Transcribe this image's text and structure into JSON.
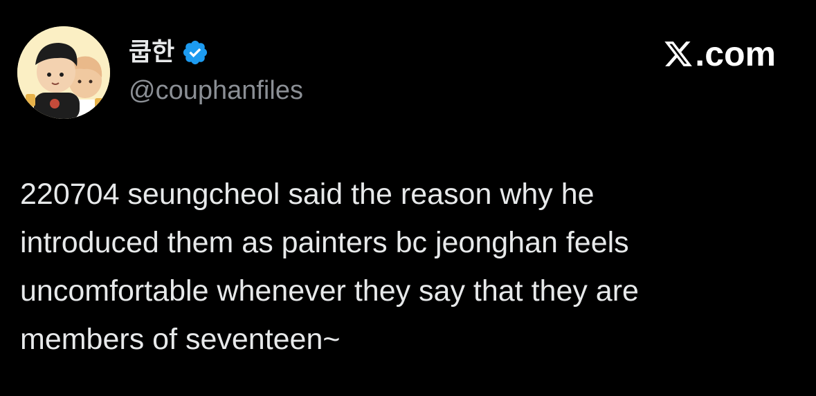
{
  "author": {
    "display_name": "쿱한",
    "handle": "@couphanfiles",
    "verified": true,
    "avatar": "couple-cartoon-avatar"
  },
  "brand": {
    "logo": "x-logo-icon",
    "suffix": ".com"
  },
  "tweet": {
    "text": "220704 seungcheol said the reason why he\nintroduced them as painters bc jeonghan feels\nuncomfortable whenever they say that they are\nmembers of seventeen~"
  },
  "colors": {
    "background": "#000000",
    "text": "#e7e9ea",
    "handle": "#8b8f95",
    "verified": "#1d9bf0"
  }
}
